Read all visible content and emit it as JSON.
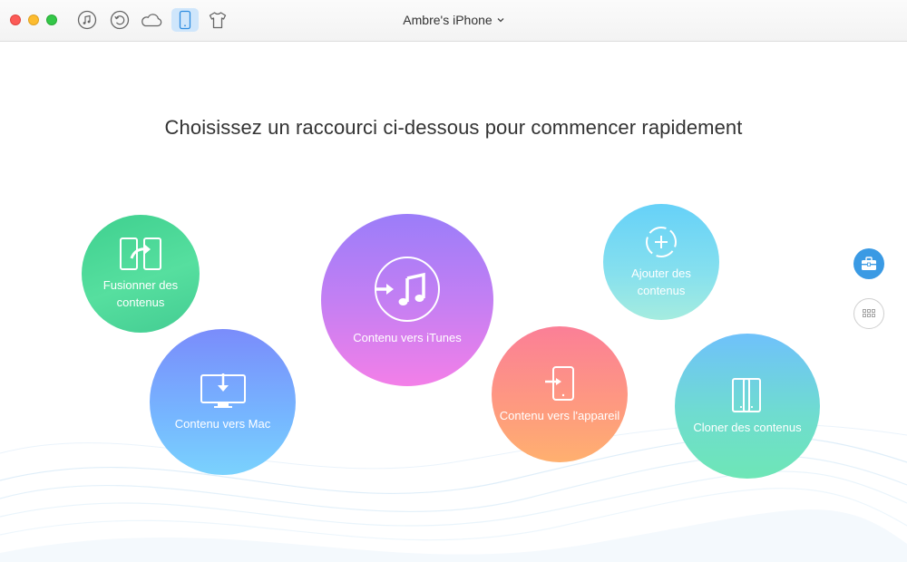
{
  "window": {
    "controls": [
      "close",
      "minimize",
      "maximize"
    ]
  },
  "toolbar": {
    "buttons": [
      {
        "icon": "music-note-icon",
        "active": false
      },
      {
        "icon": "history-icon",
        "active": false
      },
      {
        "icon": "cloud-icon",
        "active": false
      },
      {
        "icon": "iphone-icon",
        "active": true
      },
      {
        "icon": "tshirt-icon",
        "active": false
      }
    ],
    "device_name": "Ambre's iPhone"
  },
  "main": {
    "headline": "Choisissez un raccourci ci-dessous pour commencer rapidement",
    "shortcuts": {
      "merge": {
        "label_line1": "Fusionner des",
        "label_line2": "contenus",
        "icon": "merge-icon"
      },
      "to_mac": {
        "label": "Contenu vers Mac",
        "icon": "monitor-download-icon"
      },
      "to_itunes": {
        "label": "Contenu vers iTunes",
        "icon": "itunes-icon"
      },
      "to_device": {
        "label": "Contenu vers l'appareil",
        "icon": "phone-import-icon"
      },
      "add": {
        "label_line1": "Ajouter des",
        "label_line2": "contenus",
        "icon": "add-circle-icon"
      },
      "clone": {
        "label": "Cloner des contenus",
        "icon": "clone-devices-icon"
      }
    }
  },
  "sidebar": {
    "toolbox_icon": "toolbox-icon",
    "apps_icon": "grid-icon"
  },
  "colors": {
    "accent": "#3a9ae4",
    "merge": "#4fd897",
    "mac": "#76b6ff",
    "itunes": "#c37ff3",
    "device": "#fe9a7f",
    "add": "#86e0ee",
    "clone": "#6fdcd0"
  }
}
